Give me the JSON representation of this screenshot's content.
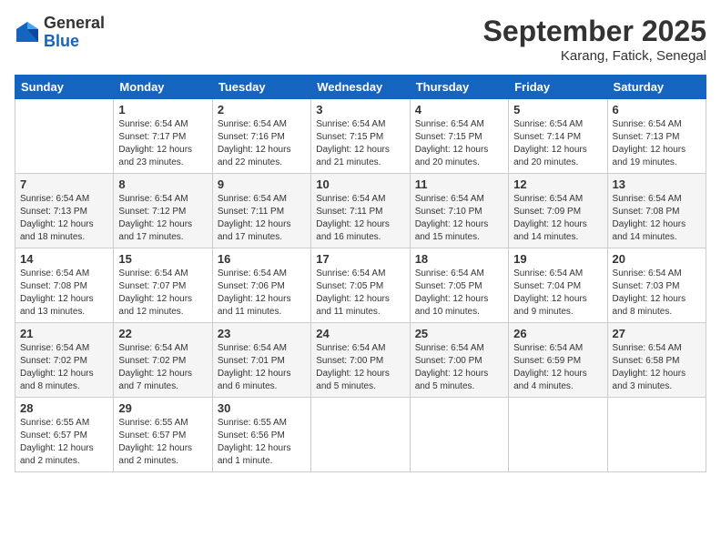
{
  "logo": {
    "general": "General",
    "blue": "Blue"
  },
  "header": {
    "month": "September 2025",
    "location": "Karang, Fatick, Senegal"
  },
  "days_of_week": [
    "Sunday",
    "Monday",
    "Tuesday",
    "Wednesday",
    "Thursday",
    "Friday",
    "Saturday"
  ],
  "weeks": [
    [
      {
        "day": "",
        "info": ""
      },
      {
        "day": "1",
        "info": "Sunrise: 6:54 AM\nSunset: 7:17 PM\nDaylight: 12 hours\nand 23 minutes."
      },
      {
        "day": "2",
        "info": "Sunrise: 6:54 AM\nSunset: 7:16 PM\nDaylight: 12 hours\nand 22 minutes."
      },
      {
        "day": "3",
        "info": "Sunrise: 6:54 AM\nSunset: 7:15 PM\nDaylight: 12 hours\nand 21 minutes."
      },
      {
        "day": "4",
        "info": "Sunrise: 6:54 AM\nSunset: 7:15 PM\nDaylight: 12 hours\nand 20 minutes."
      },
      {
        "day": "5",
        "info": "Sunrise: 6:54 AM\nSunset: 7:14 PM\nDaylight: 12 hours\nand 20 minutes."
      },
      {
        "day": "6",
        "info": "Sunrise: 6:54 AM\nSunset: 7:13 PM\nDaylight: 12 hours\nand 19 minutes."
      }
    ],
    [
      {
        "day": "7",
        "info": "Sunrise: 6:54 AM\nSunset: 7:13 PM\nDaylight: 12 hours\nand 18 minutes."
      },
      {
        "day": "8",
        "info": "Sunrise: 6:54 AM\nSunset: 7:12 PM\nDaylight: 12 hours\nand 17 minutes."
      },
      {
        "day": "9",
        "info": "Sunrise: 6:54 AM\nSunset: 7:11 PM\nDaylight: 12 hours\nand 17 minutes."
      },
      {
        "day": "10",
        "info": "Sunrise: 6:54 AM\nSunset: 7:11 PM\nDaylight: 12 hours\nand 16 minutes."
      },
      {
        "day": "11",
        "info": "Sunrise: 6:54 AM\nSunset: 7:10 PM\nDaylight: 12 hours\nand 15 minutes."
      },
      {
        "day": "12",
        "info": "Sunrise: 6:54 AM\nSunset: 7:09 PM\nDaylight: 12 hours\nand 14 minutes."
      },
      {
        "day": "13",
        "info": "Sunrise: 6:54 AM\nSunset: 7:08 PM\nDaylight: 12 hours\nand 14 minutes."
      }
    ],
    [
      {
        "day": "14",
        "info": "Sunrise: 6:54 AM\nSunset: 7:08 PM\nDaylight: 12 hours\nand 13 minutes."
      },
      {
        "day": "15",
        "info": "Sunrise: 6:54 AM\nSunset: 7:07 PM\nDaylight: 12 hours\nand 12 minutes."
      },
      {
        "day": "16",
        "info": "Sunrise: 6:54 AM\nSunset: 7:06 PM\nDaylight: 12 hours\nand 11 minutes."
      },
      {
        "day": "17",
        "info": "Sunrise: 6:54 AM\nSunset: 7:05 PM\nDaylight: 12 hours\nand 11 minutes."
      },
      {
        "day": "18",
        "info": "Sunrise: 6:54 AM\nSunset: 7:05 PM\nDaylight: 12 hours\nand 10 minutes."
      },
      {
        "day": "19",
        "info": "Sunrise: 6:54 AM\nSunset: 7:04 PM\nDaylight: 12 hours\nand 9 minutes."
      },
      {
        "day": "20",
        "info": "Sunrise: 6:54 AM\nSunset: 7:03 PM\nDaylight: 12 hours\nand 8 minutes."
      }
    ],
    [
      {
        "day": "21",
        "info": "Sunrise: 6:54 AM\nSunset: 7:02 PM\nDaylight: 12 hours\nand 8 minutes."
      },
      {
        "day": "22",
        "info": "Sunrise: 6:54 AM\nSunset: 7:02 PM\nDaylight: 12 hours\nand 7 minutes."
      },
      {
        "day": "23",
        "info": "Sunrise: 6:54 AM\nSunset: 7:01 PM\nDaylight: 12 hours\nand 6 minutes."
      },
      {
        "day": "24",
        "info": "Sunrise: 6:54 AM\nSunset: 7:00 PM\nDaylight: 12 hours\nand 5 minutes."
      },
      {
        "day": "25",
        "info": "Sunrise: 6:54 AM\nSunset: 7:00 PM\nDaylight: 12 hours\nand 5 minutes."
      },
      {
        "day": "26",
        "info": "Sunrise: 6:54 AM\nSunset: 6:59 PM\nDaylight: 12 hours\nand 4 minutes."
      },
      {
        "day": "27",
        "info": "Sunrise: 6:54 AM\nSunset: 6:58 PM\nDaylight: 12 hours\nand 3 minutes."
      }
    ],
    [
      {
        "day": "28",
        "info": "Sunrise: 6:55 AM\nSunset: 6:57 PM\nDaylight: 12 hours\nand 2 minutes."
      },
      {
        "day": "29",
        "info": "Sunrise: 6:55 AM\nSunset: 6:57 PM\nDaylight: 12 hours\nand 2 minutes."
      },
      {
        "day": "30",
        "info": "Sunrise: 6:55 AM\nSunset: 6:56 PM\nDaylight: 12 hours\nand 1 minute."
      },
      {
        "day": "",
        "info": ""
      },
      {
        "day": "",
        "info": ""
      },
      {
        "day": "",
        "info": ""
      },
      {
        "day": "",
        "info": ""
      }
    ]
  ]
}
